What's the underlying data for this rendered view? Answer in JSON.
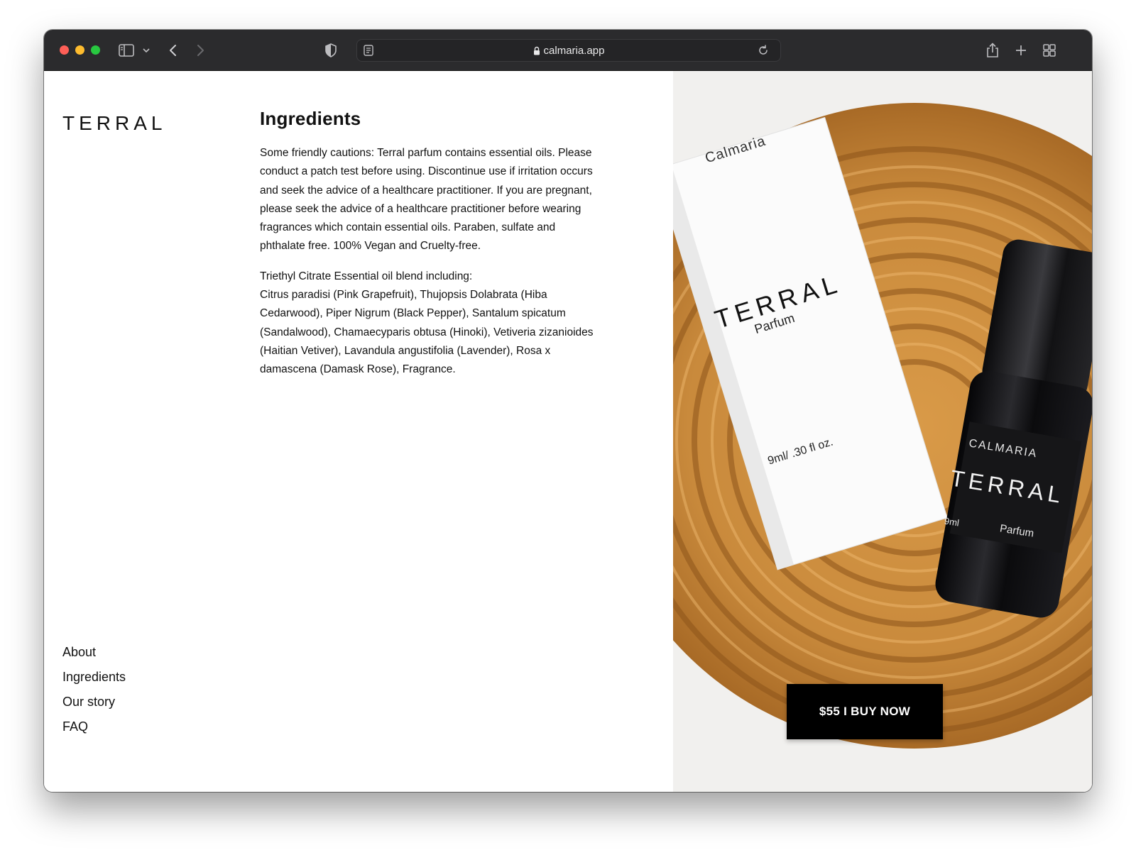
{
  "browser": {
    "url": "calmaria.app"
  },
  "site": {
    "logo": "TERRAL"
  },
  "article": {
    "title": "Ingredients",
    "paragraph1": "Some friendly cautions: Terral parfum contains essential oils. Please conduct a patch test before using. Discontinue use if irritation occurs and seek the advice of a healthcare practitioner. If you are pregnant, please seek the advice of a healthcare practitioner before wearing fragrances which contain essential oils. Paraben, sulfate and phthalate free. 100% Vegan and Cruelty-free.",
    "paragraph2_line1": "Triethyl Citrate Essential oil blend including:",
    "paragraph2_line2": "Citrus paradisi (Pink Grapefruit), Thujopsis Dolabrata (Hiba Cedarwood), Piper Nigrum (Black Pepper), Santalum spicatum (Sandalwood), Chamaecyparis obtusa (Hinoki), Vetiveria zizanioides (Haitian Vetiver), Lavandula angustifolia (Lavender), Rosa x damascena (Damask Rose), Fragrance."
  },
  "nav": {
    "items": [
      {
        "label": "About"
      },
      {
        "label": "Ingredients"
      },
      {
        "label": "Our story"
      },
      {
        "label": "FAQ"
      }
    ]
  },
  "product_photo": {
    "box_brand": "Calmaria",
    "box_name": "TERRAL",
    "box_type": "Parfum",
    "box_volume": "9ml/ .30 fl oz.",
    "bottle_brand": "CALMARIA",
    "bottle_name": "TERRAL",
    "bottle_volume": "9ml",
    "bottle_type": "Parfum"
  },
  "cta": {
    "label": "$55 I BUY NOW"
  },
  "colors": {
    "toolbar": "#2b2b2d",
    "button": "#000000",
    "wood": "#c88a3e"
  }
}
